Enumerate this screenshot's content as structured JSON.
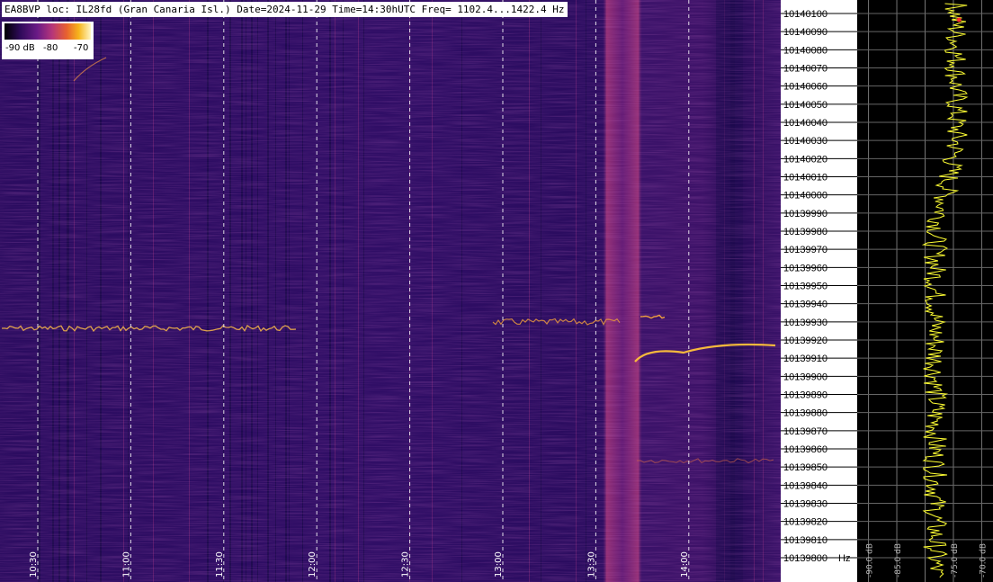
{
  "header": {
    "text": "EA8BVP loc: IL28fd (Gran Canaria Isl.) Date=2024-11-29 Time=14:30hUTC Freq= 1102.4...1422.4 Hz"
  },
  "colorbar": {
    "labels": [
      "-90 dB",
      "-80",
      "-70"
    ],
    "colors": [
      "#000000",
      "#2e0a59",
      "#6a1a86",
      "#b5357a",
      "#e8612f",
      "#f6b51b",
      "#fff6c4"
    ]
  },
  "chart_data": [
    {
      "type": "heatmap",
      "title": "EA8BVP loc: IL28fd (Gran Canaria Isl.) Date=2024-11-29 Time=14:30hUTC Freq= 1102.4...1422.4 Hz",
      "xlabel": "",
      "ylabel": "",
      "time_ticks": [
        "10:30",
        "11:00",
        "11:30",
        "12:00",
        "12:30",
        "13:00",
        "13:30",
        "14:00"
      ],
      "freq_ticks": [
        10140100,
        10140090,
        10140080,
        10140070,
        10140060,
        10140050,
        10140040,
        10140030,
        10140020,
        10140010,
        10140000,
        10139990,
        10139980,
        10139970,
        10139960,
        10139950,
        10139940,
        10139930,
        10139920,
        10139910,
        10139900,
        10139890,
        10139880,
        10139870,
        10139860,
        10139850,
        10139840,
        10139830,
        10139820,
        10139810,
        10139800
      ],
      "freq_unit": "Hz",
      "color_range_db": [
        -90,
        -70
      ],
      "grid": true
    },
    {
      "type": "line",
      "xlabel": "",
      "ylabel": "",
      "x_ticks": [
        "-90.0 dB",
        "-85.0 dB",
        "-75.0 dB",
        "-70.0 dB"
      ],
      "xlim": [
        -92,
        -68
      ],
      "ylim": [
        10139797,
        10140103
      ],
      "grid": true
    }
  ]
}
